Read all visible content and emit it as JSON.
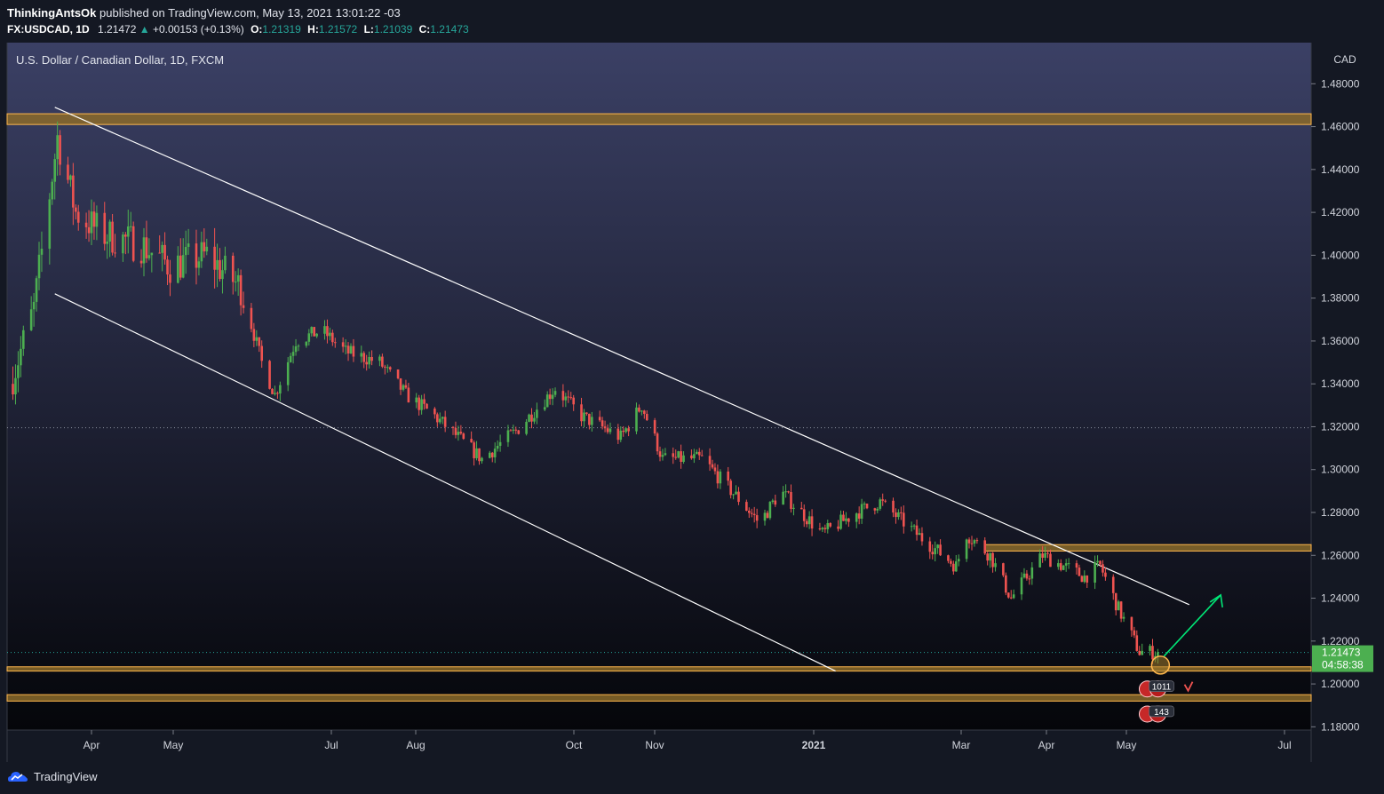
{
  "header": {
    "author": "ThinkingAntsOk",
    "published_text": "published on TradingView.com, May 13, 2021 13:01:22 -03",
    "symbol": "FX:USDCAD, 1D",
    "last": "1.21472",
    "change": "+0.00153 (+0.13%)",
    "o_label": "O:",
    "o": "1.21319",
    "h_label": "H:",
    "h": "1.21572",
    "l_label": "L:",
    "l": "1.21039",
    "c_label": "C:",
    "c": "1.21473"
  },
  "footer": {
    "brand": "TradingView"
  },
  "colors": {
    "up": "#26a69a",
    "up_candle": "#4caf50",
    "down": "#ef5350",
    "zone_fill": "#8a6a2a",
    "zone_border": "#ffb74d",
    "channel": "#ffffff",
    "arrow": "#00e676",
    "price_tag": "#4caf50"
  },
  "chart_data": {
    "type": "candlestick",
    "title": "U.S. Dollar / Canadian Dollar, 1D, FXCM",
    "currency": "CAD",
    "ylim": [
      1.176,
      1.49
    ],
    "y_ticks": [
      "1.48000",
      "1.46000",
      "1.44000",
      "1.42000",
      "1.40000",
      "1.38000",
      "1.36000",
      "1.34000",
      "1.32000",
      "1.30000",
      "1.28000",
      "1.26000",
      "1.24000",
      "1.22000",
      "1.20000",
      "1.18000"
    ],
    "x_ticks": [
      "Apr",
      "May",
      "Jul",
      "Aug",
      "Oct",
      "Nov",
      "2021",
      "Mar",
      "Apr",
      "May",
      "Jul"
    ],
    "last_price": "1.21473",
    "countdown": "04:58:38",
    "anchors": [
      [
        "2020-03-01",
        1.34
      ],
      [
        "2020-03-10",
        1.375
      ],
      [
        "2020-03-19",
        1.455
      ],
      [
        "2020-03-26",
        1.42
      ],
      [
        "2020-04-05",
        1.41
      ],
      [
        "2020-04-20",
        1.405
      ],
      [
        "2020-05-01",
        1.395
      ],
      [
        "2020-05-15",
        1.4
      ],
      [
        "2020-05-28",
        1.385
      ],
      [
        "2020-06-05",
        1.35
      ],
      [
        "2020-06-10",
        1.335
      ],
      [
        "2020-06-18",
        1.36
      ],
      [
        "2020-06-28",
        1.365
      ],
      [
        "2020-07-07",
        1.355
      ],
      [
        "2020-07-20",
        1.35
      ],
      [
        "2020-07-30",
        1.335
      ],
      [
        "2020-08-10",
        1.325
      ],
      [
        "2020-08-28",
        1.305
      ],
      [
        "2020-09-10",
        1.318
      ],
      [
        "2020-09-25",
        1.338
      ],
      [
        "2020-10-05",
        1.325
      ],
      [
        "2020-10-20",
        1.315
      ],
      [
        "2020-10-28",
        1.33
      ],
      [
        "2020-11-05",
        1.305
      ],
      [
        "2020-11-20",
        1.305
      ],
      [
        "2020-12-05",
        1.285
      ],
      [
        "2020-12-12",
        1.275
      ],
      [
        "2020-12-20",
        1.29
      ],
      [
        "2021-01-05",
        1.27
      ],
      [
        "2021-01-18",
        1.28
      ],
      [
        "2021-01-27",
        1.285
      ],
      [
        "2021-02-10",
        1.27
      ],
      [
        "2021-02-25",
        1.255
      ],
      [
        "2021-03-01",
        1.27
      ],
      [
        "2021-03-10",
        1.26
      ],
      [
        "2021-03-18",
        1.24
      ],
      [
        "2021-03-30",
        1.26
      ],
      [
        "2021-04-15",
        1.25
      ],
      [
        "2021-04-21",
        1.255
      ],
      [
        "2021-04-28",
        1.235
      ],
      [
        "2021-05-06",
        1.215
      ],
      [
        "2021-05-13",
        1.2147
      ]
    ],
    "support_resistance_zones": [
      [
        1.461,
        1.466
      ],
      [
        1.262,
        1.265
      ],
      [
        1.206,
        1.208
      ],
      [
        1.192,
        1.195
      ]
    ],
    "channel_lines": [
      [
        [
          "2020-03-18",
          1.469
        ],
        [
          "2021-05-25",
          1.237
        ]
      ],
      [
        [
          "2020-03-18",
          1.382
        ],
        [
          "2021-01-10",
          1.206
        ]
      ]
    ],
    "events": [
      {
        "label": "1011"
      },
      {
        "label": "143"
      }
    ]
  }
}
